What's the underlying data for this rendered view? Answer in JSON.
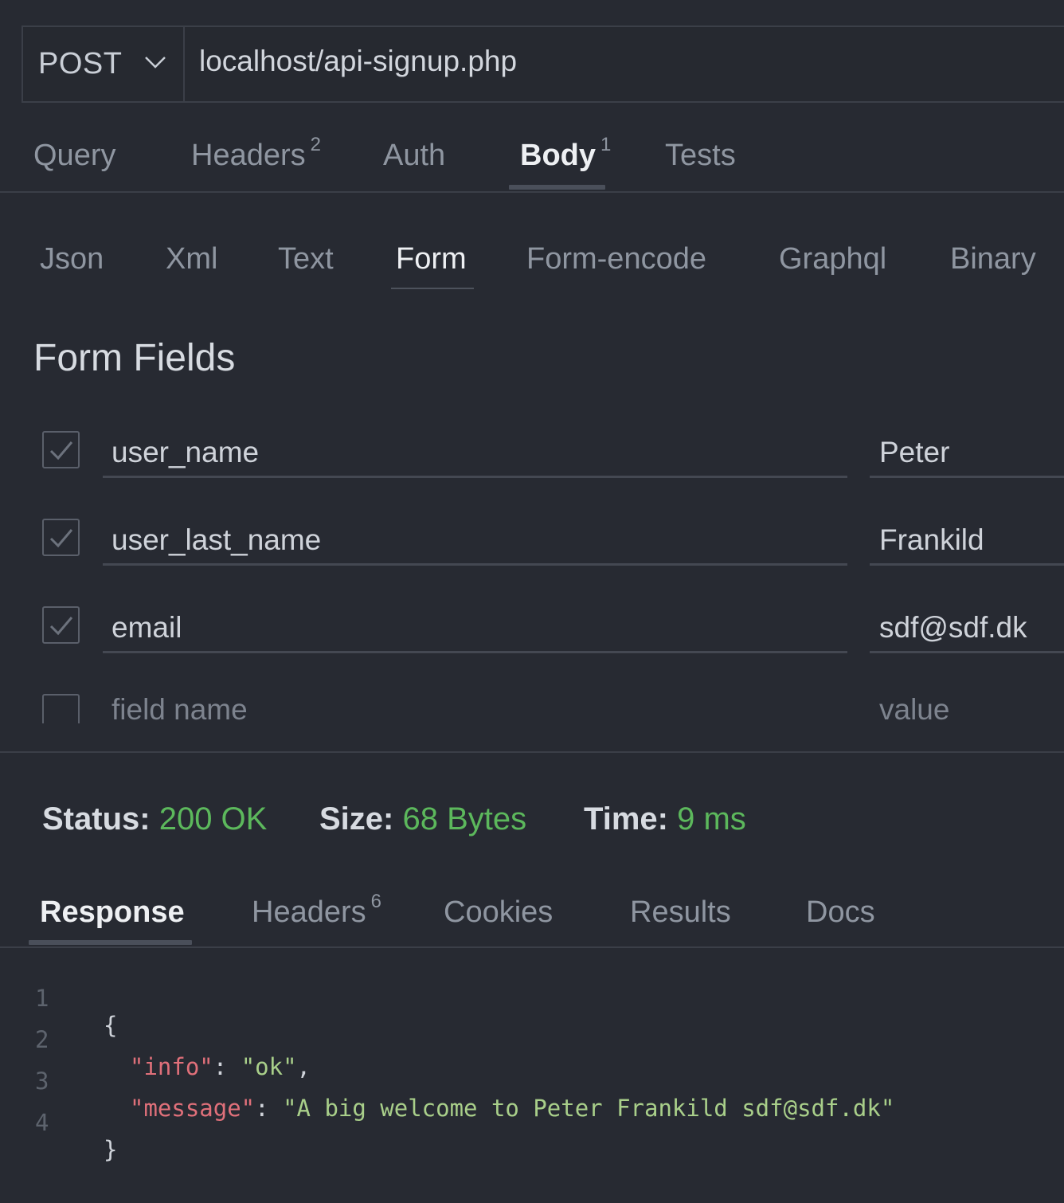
{
  "request": {
    "method": "POST",
    "url": "localhost/api-signup.php"
  },
  "request_tabs": [
    {
      "label": "Query",
      "badge": ""
    },
    {
      "label": "Headers",
      "badge": "2"
    },
    {
      "label": "Auth",
      "badge": ""
    },
    {
      "label": "Body",
      "badge": "1"
    },
    {
      "label": "Tests",
      "badge": ""
    }
  ],
  "active_request_tab": "Body",
  "body_types": [
    "Json",
    "Xml",
    "Text",
    "Form",
    "Form-encode",
    "Graphql",
    "Binary"
  ],
  "active_body_type": "Form",
  "form": {
    "title": "Form Fields",
    "fields": [
      {
        "checked": true,
        "name": "user_name",
        "value": "Peter"
      },
      {
        "checked": true,
        "name": "user_last_name",
        "value": "Frankild"
      },
      {
        "checked": true,
        "name": "email",
        "value": "sdf@sdf.dk"
      }
    ],
    "new_field_placeholder": "field name",
    "new_value_placeholder": "value"
  },
  "status": {
    "status_label": "Status:",
    "status_value": "200 OK",
    "size_label": "Size:",
    "size_value": "68 Bytes",
    "time_label": "Time:",
    "time_value": "9 ms"
  },
  "response_tabs": [
    {
      "label": "Response",
      "badge": ""
    },
    {
      "label": "Headers",
      "badge": "6"
    },
    {
      "label": "Cookies",
      "badge": ""
    },
    {
      "label": "Results",
      "badge": ""
    },
    {
      "label": "Docs",
      "badge": ""
    }
  ],
  "active_response_tab": "Response",
  "response_body": {
    "line_numbers": [
      "1",
      "2",
      "3",
      "4"
    ],
    "open_brace": "{",
    "close_brace": "}",
    "info_key": "\"info\"",
    "info_value": "\"ok\"",
    "message_key": "\"message\"",
    "message_value": "\"A big welcome to Peter Frankild sdf@sdf.dk\""
  },
  "colors": {
    "background": "#272a32",
    "success": "#5cb85c",
    "json_key": "#e0707a",
    "json_string": "#a9cf8a"
  }
}
